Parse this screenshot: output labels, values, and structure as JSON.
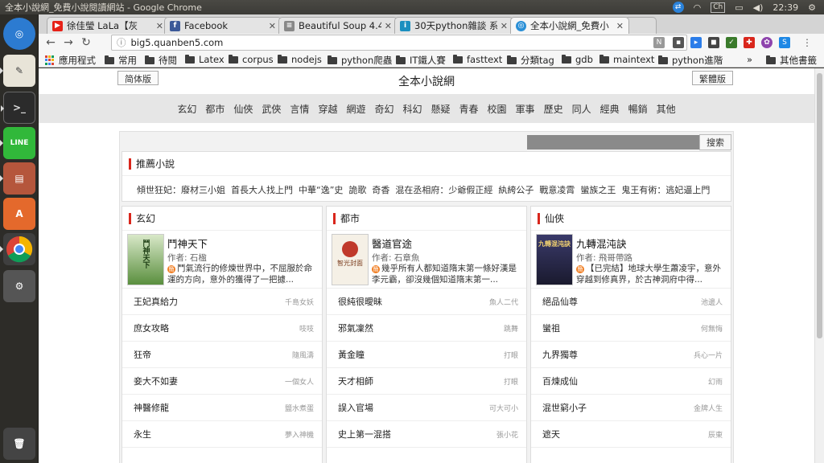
{
  "os": {
    "window_title": "全本小說網_免費小說閱讀網站 - Google Chrome",
    "tray": {
      "keyboard": "Ch",
      "time": "22:39"
    }
  },
  "tabs": [
    {
      "label": "徐佳瑩 LaLa【灰",
      "icon": "youtube-icon",
      "color": "#e62117"
    },
    {
      "label": "Facebook",
      "icon": "facebook-icon",
      "color": "#3b5998"
    },
    {
      "label": "Beautiful Soup 4.4.",
      "icon": "document-icon",
      "color": "#666666"
    },
    {
      "label": "30天python雜談 系",
      "icon": "ithome-icon",
      "color": "#1a8fbf"
    },
    {
      "label": "全本小說網_免費小",
      "icon": "globe-icon",
      "color": "#2a8fd6"
    }
  ],
  "omnibox": {
    "url": "big5.quanben5.com"
  },
  "bookmarks": [
    {
      "label": "應用程式",
      "kind": "apps"
    },
    {
      "label": "常用",
      "kind": "folder"
    },
    {
      "label": "待閱",
      "kind": "folder"
    },
    {
      "label": "Latex",
      "kind": "folder"
    },
    {
      "label": "corpus",
      "kind": "folder"
    },
    {
      "label": "nodejs",
      "kind": "folder"
    },
    {
      "label": "python爬蟲",
      "kind": "folder"
    },
    {
      "label": "IT鐵人賽",
      "kind": "folder"
    },
    {
      "label": "fasttext",
      "kind": "folder"
    },
    {
      "label": "分類tag",
      "kind": "folder"
    },
    {
      "label": "gdb",
      "kind": "folder"
    },
    {
      "label": "maintext",
      "kind": "folder"
    },
    {
      "label": "python進階",
      "kind": "folder"
    }
  ],
  "bookmarks_overflow": "»",
  "other_bookmarks": "其他書籤",
  "site": {
    "simplified_button": "简体版",
    "traditional_button": "繁體版",
    "title": "全本小說網",
    "categories": [
      "玄幻",
      "都市",
      "仙俠",
      "武俠",
      "言情",
      "穿越",
      "網遊",
      "奇幻",
      "科幻",
      "懸疑",
      "青春",
      "校園",
      "軍事",
      "歷史",
      "同人",
      "經典",
      "暢銷",
      "其他"
    ],
    "search_button": "搜索",
    "recommend": {
      "title": "推薦小說",
      "items": [
        "傾世狂妃：廢材三小姐",
        "首長大人找上門",
        "中華“逸”史",
        "詭歌",
        "奇香",
        "混在丞相府：少爺假正經",
        "紈絝公子",
        "戰意凌霄",
        "蠻族之王",
        "鬼王有術：逃妃逼上門"
      ]
    },
    "columns": [
      {
        "title": "玄幻",
        "featured": {
          "title": "鬥神天下",
          "author": "作者: 石楹",
          "desc": "鬥氣流行的修煉世界中，不屈服於命運的方向，意外的獲得了一把據...",
          "cover_text": "鬥神天下",
          "cover_color": "#5a8f3e"
        },
        "rows": [
          {
            "name": "王妃真給力",
            "author": "千島女妖"
          },
          {
            "name": "庶女攻略",
            "author": "吱吱"
          },
          {
            "name": "狂帝",
            "author": "隨風濤"
          },
          {
            "name": "妾大不如妻",
            "author": "一個女人"
          },
          {
            "name": "神醫修龍",
            "author": "鹽水煮蛋"
          },
          {
            "name": "永生",
            "author": "夢入神機"
          }
        ]
      },
      {
        "title": "都市",
        "featured": {
          "title": "醫道官途",
          "author": "作者: 石章魚",
          "desc": "幾乎所有人都知道隋末第一條好漢是李元霸，卻沒幾個知道隋末第一...",
          "cover_text": "智光封面",
          "cover_color": "#c0392b"
        },
        "rows": [
          {
            "name": "很純很曖昧",
            "author": "魚人二代"
          },
          {
            "name": "邪氣凜然",
            "author": "跳舞"
          },
          {
            "name": "黃金瞳",
            "author": "打眼"
          },
          {
            "name": "天才相師",
            "author": "打眼"
          },
          {
            "name": "誤入官場",
            "author": "可大可小"
          },
          {
            "name": "史上第一混搭",
            "author": "張小花"
          }
        ]
      },
      {
        "title": "仙俠",
        "featured": {
          "title": "九轉混沌訣",
          "author": "作者: 飛哥帶路",
          "desc": "【已完結】地球大學生蕭凌宇，意外穿越到修真界，於古神洞府中得...",
          "cover_text": "九轉混沌訣",
          "cover_color": "#2c2c5a"
        },
        "rows": [
          {
            "name": "絕品仙尊",
            "author": "池邊人"
          },
          {
            "name": "蠻祖",
            "author": "何無悔"
          },
          {
            "name": "九界獨尊",
            "author": "兵心一片"
          },
          {
            "name": "百煉成仙",
            "author": "幻雨"
          },
          {
            "name": "混世窮小子",
            "author": "金牌人生"
          },
          {
            "name": "遮天",
            "author": "辰東"
          }
        ]
      }
    ]
  }
}
